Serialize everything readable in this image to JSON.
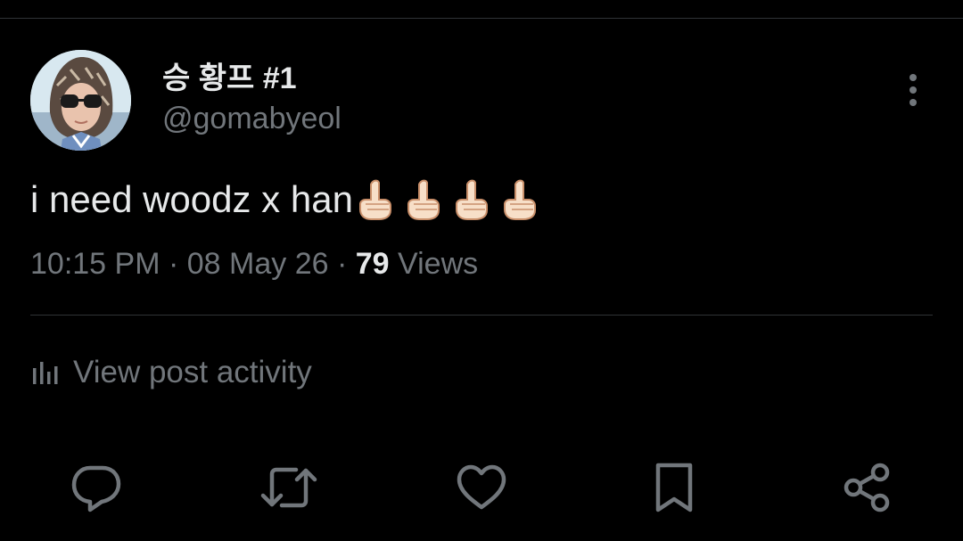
{
  "author": {
    "display_name": "승 황프 #1",
    "handle": "@gomabyeol"
  },
  "post": {
    "text": "i need woodz x han",
    "emojis": [
      "index-pointing-up-icon",
      "index-pointing-up-icon",
      "index-pointing-up-icon",
      "index-pointing-up-icon"
    ],
    "time": "10:15 PM",
    "separator": "·",
    "date": "08 May 26",
    "views_count": "79",
    "views_label": "Views"
  },
  "activity": {
    "label": "View post activity",
    "icon": "analytics-icon"
  },
  "actions": [
    {
      "name": "reply-button",
      "icon": "reply-icon"
    },
    {
      "name": "repost-button",
      "icon": "repost-icon"
    },
    {
      "name": "like-button",
      "icon": "heart-icon"
    },
    {
      "name": "bookmark-button",
      "icon": "bookmark-icon"
    },
    {
      "name": "share-button",
      "icon": "share-icon"
    }
  ],
  "colors": {
    "background": "#000000",
    "primary_text": "#e7e9ea",
    "secondary_text": "#71767b",
    "divider": "#2f3336"
  }
}
